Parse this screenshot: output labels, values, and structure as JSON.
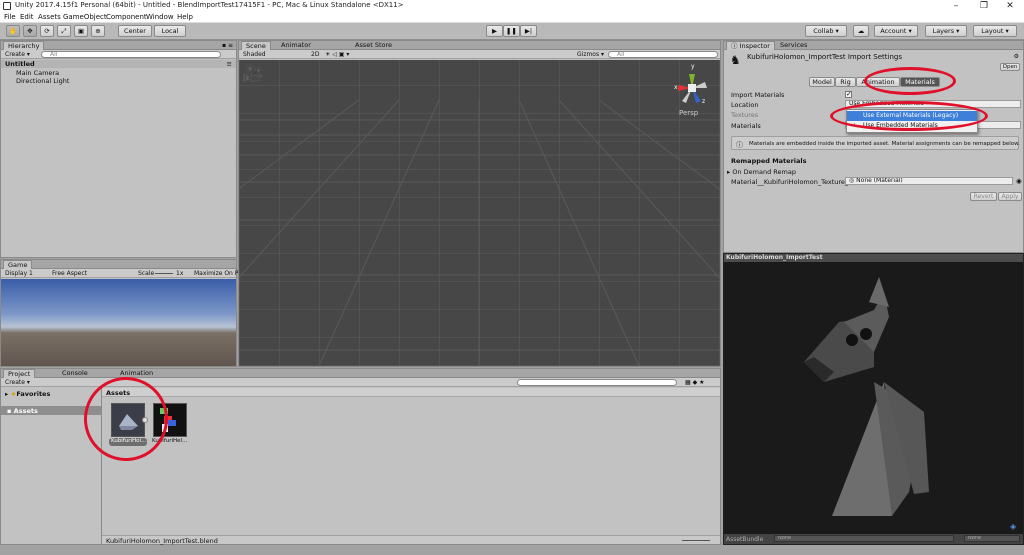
{
  "window": {
    "title": "Unity 2017.4.15f1 Personal (64bit) - Untitled - BlendImportTest17415F1 - PC, Mac & Linux Standalone <DX11>"
  },
  "menu": [
    "File",
    "Edit",
    "Assets",
    "GameObject",
    "Component",
    "Window",
    "Help"
  ],
  "toolbar": {
    "center": "Center",
    "local": "Local",
    "collab": "Collab ▾",
    "account": "Account ▾",
    "layers": "Layers ▾",
    "layout": "Layout ▾"
  },
  "hierarchy": {
    "tab": "Hierarchy",
    "create": "Create ▾",
    "search_placeholder": "All",
    "scene": "Untitled",
    "items": [
      "Main Camera",
      "Directional Light"
    ]
  },
  "scene": {
    "tabs": [
      "Scene",
      "Animator",
      "Asset Store"
    ],
    "shading": "Shaded",
    "mode2d": "2D",
    "gizmos": "Gizmos ▾",
    "search_placeholder": "All",
    "persp": "Persp",
    "axes": {
      "y": "y",
      "x": "x",
      "z": "z"
    }
  },
  "game": {
    "tab": "Game",
    "display": "Display 1",
    "aspect": "Free Aspect",
    "scale_label": "Scale",
    "scale_value": "1x",
    "maximize": "Maximize On Pl"
  },
  "project": {
    "tabs": [
      "Project",
      "Console",
      "Animation"
    ],
    "create": "Create ▾",
    "favorites": "Favorites",
    "assets_root": "Assets",
    "breadcrumb": "Assets",
    "items": [
      "KubifuriHol...",
      "KubifuriHel..."
    ],
    "status_path": "KubifuriHolomon_ImportTest.blend"
  },
  "inspector": {
    "tabs": [
      "Inspector",
      "Services"
    ],
    "title": "KubifuriHolomon_ImportTest Import Settings",
    "open": "Open",
    "subtabs": [
      "Model",
      "Rig",
      "Animation",
      "Materials"
    ],
    "import_materials": "Import Materials",
    "location": "Location",
    "location_value": "Use Embedded Materials",
    "textures": "Textures",
    "materials": "Materials",
    "dropdown": [
      "Use External Materials (Legacy)",
      "Use Embedded Materials"
    ],
    "info": "Materials are embedded inside the imported asset. Material assignments can be remapped below.",
    "remapped_header": "Remapped Materials",
    "on_demand": "On Demand Remap",
    "remap_key": "Material__KubifuriHolomon_Texture_",
    "remap_value": "None (Material)",
    "revert": "Revert",
    "apply": "Apply"
  },
  "preview": {
    "title": "KubifuriHolomon_ImportTest",
    "assetbundle_label": "AssetBundle",
    "none1": "None",
    "none2": "None"
  }
}
